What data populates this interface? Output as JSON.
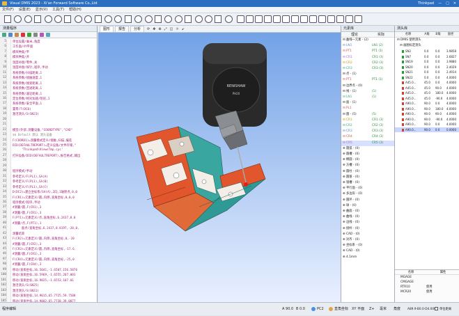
{
  "window": {
    "title": "Visual DMIS 2023 - Xi'an Forward Software Co.,Ltd",
    "user": "Thinkpad",
    "controls": [
      "—",
      "□",
      "✕"
    ]
  },
  "menu": [
    "文件(F)",
    "设置(E)",
    "显示(V)",
    "工具(T)",
    "帮助(H)"
  ],
  "left_panel": {
    "title": "测量程序",
    "lines": [
      {
        "n": "5",
        "t": "单位设置/毫米,角度",
        "c": ""
      },
      {
        "n": "6",
        "t": "工作面/XY平面",
        "c": ""
      },
      {
        "n": "7",
        "t": "模块种类/平",
        "c": ""
      },
      {
        "n": "8",
        "t": "模块种类/开",
        "c": ""
      },
      {
        "n": "9",
        "t": "温度补偿/零件,关",
        "c": ""
      },
      {
        "n": "10",
        "t": "温度补偿/探针,程序,手动",
        "c": ""
      },
      {
        "n": "11",
        "t": "系统参数/扫描距离,1",
        "c": ""
      },
      {
        "n": "12",
        "t": "系统参数/接触速度,1",
        "c": ""
      },
      {
        "n": "13",
        "t": "系统参数/搜索距离,1",
        "c": ""
      },
      {
        "n": "14",
        "t": "系统参数/回退距离,1",
        "c": ""
      },
      {
        "n": "15",
        "t": "系统参数/逼近距离,1",
        "c": ""
      },
      {
        "n": "16",
        "t": "定位参数/相对加速/阻尼,1",
        "c": ""
      },
      {
        "n": "17",
        "t": "系统参数/安全平面,1",
        "c": ""
      },
      {
        "n": "18",
        "t": "置零/T(DC0)",
        "c": ""
      },
      {
        "n": "19",
        "t": "激活测头/S(SN23)",
        "c": ""
      },
      {
        "n": "20",
        "t": "",
        "c": ""
      },
      {
        "n": "21",
        "t": "",
        "c": ""
      },
      {
        "n": "22",
        "t": "模型/外部,测量设备,\"COORDTYPE\",\"CAD\"",
        "c": ""
      },
      {
        "n": "23",
        "t": "$$ Default 默认 测头设备",
        "c": "gray"
      },
      {
        "n": "24",
        "t": "F(COORD1)=测量模式定义/接触,扫描,偏差",
        "c": ""
      },
      {
        "n": "25",
        "t": "DID(DEFAULTREPORT)=定义设备/文件存储,\"",
        "c": ""
      },
      {
        "n": "26",
        "t": "     'Thinkpad\\ViewsTmp.cyc'",
        "c": ""
      },
      {
        "n": "27",
        "t": "打开设备/DID(DEFAULTREPORT),报告格式,输出",
        "c": ""
      },
      {
        "n": "28",
        "t": "",
        "c": ""
      },
      {
        "n": "29",
        "t": "",
        "c": ""
      },
      {
        "n": "30",
        "t": "程序模式/手动",
        "c": ""
      },
      {
        "n": "31",
        "t": "参考定义/F(PL1),SA(A)",
        "c": ""
      },
      {
        "n": "32",
        "t": "参考定义/F(PL1),SA(B)",
        "c": ""
      },
      {
        "n": "33",
        "t": "参考定义/F(PL1),SA(C)",
        "c": ""
      },
      {
        "n": "34",
        "t": "D(DC2)=建立坐标系/SA(A),Z向,1轴原点,0,0",
        "c": ""
      },
      {
        "n": "35",
        "t": "F(CR1)=元素定义/圆,内侧,直角坐标,0,0,0",
        "c": ""
      },
      {
        "n": "36",
        "t": "程序模式/程序,手动",
        "c": ""
      },
      {
        "n": "37",
        "t": "#测量/圆,F(CR1),3",
        "c": ""
      },
      {
        "n": "38",
        "t": "#测量/圆,F(CR1),3",
        "c": ""
      },
      {
        "n": "39",
        "t": "F(PT1)=元素定义/点,直角坐标,6.2437,8.8",
        "c": ""
      },
      {
        "n": "40",
        "t": "#测量/点,F(PT1),1",
        "c": ""
      },
      {
        "n": "41",
        "t": "     面点/直角坐标,6.2437,8.8197,-20,0,",
        "c": ""
      },
      {
        "n": "42",
        "t": "测量结束",
        "c": ""
      },
      {
        "n": "43",
        "t": "F(CR2)=元素定义/圆,内侧,直角坐标,0,-20",
        "c": ""
      },
      {
        "n": "44",
        "t": "#测量/圆,F(CR2),3",
        "c": ""
      },
      {
        "n": "45",
        "t": "F(CR3)=元素定义/圆,内侧,直角坐标,-17.6",
        "c": ""
      },
      {
        "n": "46",
        "t": "#测量/圆,F(CR3),3",
        "c": ""
      },
      {
        "n": "97",
        "t": "F(CR4)=元素定义/圆,内侧,直角坐标,-25,0",
        "c": ""
      },
      {
        "n": "98",
        "t": "#测量/圆,F(CR4),3",
        "c": ""
      },
      {
        "n": "99",
        "t": "移动/直角坐标,16.5041,-1.6507,156.5876",
        "c": ""
      },
      {
        "n": "100",
        "t": "移动/直角坐标,16.5969,-1.6555,207.001",
        "c": ""
      },
      {
        "n": "101",
        "t": "移动/直角坐标,16.9025,-1.6553,107.01",
        "c": ""
      },
      {
        "n": "102",
        "t": "激活测头/S(SN25)",
        "c": ""
      },
      {
        "n": "103",
        "t": "激活测头/S(SN31)",
        "c": ""
      },
      {
        "n": "104",
        "t": "移动/直角坐标,14.9015,65.7725,59.7588",
        "c": ""
      },
      {
        "n": "105",
        "t": "移动/直角坐标,14.9002,65.7738,39.0077",
        "c": ""
      }
    ]
  },
  "viewport": {
    "tabs": [
      "图形",
      "报告",
      "分析"
    ],
    "probe_label": "RENISHAW",
    "probe_sub": "PH20"
  },
  "right_panel": {
    "tabs": [
      "元素库"
    ],
    "headers": [
      "理论",
      "实际"
    ],
    "rows": [
      {
        "n": "⊟ 曲线一元素 - (2)",
        "v": ""
      },
      {
        "n": "  ⊟ LN1",
        "v": "LN1 (2)"
      },
      {
        "n": "  ⊟ PT1",
        "v": "PT1 (1)"
      },
      {
        "n": "  ⊟ CR1",
        "v": "CR1 (3)"
      },
      {
        "n": "  ⊟ CR2",
        "v": "CR2 (3)"
      },
      {
        "n": "  ⊟ CR3",
        "v": "CR3 (3)"
      },
      {
        "n": "⊟ 点 - (1)",
        "v": ""
      },
      {
        "n": "  ⊟ PT1",
        "v": "PT1 (1)"
      },
      {
        "n": "⊟ 边界点 - (0)",
        "v": ""
      },
      {
        "n": "⊟ 线 - (1)",
        "v": "(1)"
      },
      {
        "n": "  ⊟ LN1",
        "v": "(1)"
      },
      {
        "n": "⊟ 面 - (1)",
        "v": ""
      },
      {
        "n": "  ⊟ PL1",
        "v": ""
      },
      {
        "n": "⊟ 圆 - (5)",
        "v": "(5)"
      },
      {
        "n": "  ⊟ CR1",
        "v": "CR1 (3)"
      },
      {
        "n": "  ⊟ CR2",
        "v": "CR2 (3)"
      },
      {
        "n": "  ⊟ CR3",
        "v": "CR3 (3)"
      },
      {
        "n": "  ⊟ CR4",
        "v": "CR4 (3)"
      },
      {
        "n": "  ⊟ CR5",
        "v": "CR5 (3)"
      },
      {
        "n": "⊕ 圆弧 - (0)",
        "v": ""
      },
      {
        "n": "⊕ 圆槽 - (0)",
        "v": ""
      },
      {
        "n": "⊕ 椭圆 - (0)",
        "v": ""
      },
      {
        "n": "⊕ 方槽 - (0)",
        "v": ""
      },
      {
        "n": "⊕ 圆柱 - (0)",
        "v": ""
      },
      {
        "n": "⊕ 圆锥 - (0)",
        "v": ""
      },
      {
        "n": "⊕ 锥槽 - (0)",
        "v": ""
      },
      {
        "n": "⊕ 平行面 - (0)",
        "v": ""
      },
      {
        "n": "⊕ 多边形 - (0)",
        "v": ""
      },
      {
        "n": "⊕ 圆环 - (0)",
        "v": ""
      },
      {
        "n": "⊕ 球 - (0)",
        "v": ""
      },
      {
        "n": "⊕ 曲面 - (0)",
        "v": ""
      },
      {
        "n": "⊕ 曲线 - (0)",
        "v": ""
      },
      {
        "n": "⊕ 边线 - (0)",
        "v": ""
      },
      {
        "n": "⊕ 接杆 - (0)",
        "v": ""
      },
      {
        "n": "⊕ CAD - (0)",
        "v": ""
      },
      {
        "n": "⊕ 对齐 - (0)",
        "v": ""
      },
      {
        "n": "⊕ 坐标系 - (0)",
        "v": ""
      },
      {
        "n": "⊕ CAD - (0)",
        "v": ""
      },
      {
        "n": "  ⊕ 4.1mm",
        "v": ""
      }
    ]
  },
  "far_panel": {
    "tabs": [
      "测头库"
    ],
    "headers": [
      "名称",
      "A角",
      "B角",
      "直径"
    ],
    "root": "DMIS 使用测头",
    "group": "画图标定测头",
    "rows": [
      {
        "n": "SN2",
        "a": "0.0",
        "b": "0.0",
        "d": "3.9858"
      },
      {
        "n": "SN7",
        "a": "0.0",
        "b": "0.0",
        "d": "2.6827"
      },
      {
        "n": "SN19",
        "a": "0.0",
        "b": "0.0",
        "d": "3.9880"
      },
      {
        "n": "SN20",
        "a": "0.0",
        "b": "0.0",
        "d": "2.4029"
      },
      {
        "n": "SN21",
        "a": "0.0",
        "b": "0.0",
        "d": "2.4914"
      },
      {
        "n": "SN22",
        "a": "0.0",
        "b": "0.0",
        "d": "4.0000"
      },
      {
        "n": "A45.0...",
        "a": "45.0",
        "b": "0.0",
        "d": "4.0000"
      },
      {
        "n": "A45.0...",
        "a": "45.0",
        "b": "90.0",
        "d": "4.0000"
      },
      {
        "n": "A45.0...",
        "a": "45.0",
        "b": "180.0",
        "d": "4.0000"
      },
      {
        "n": "A45.0...",
        "a": "45.0",
        "b": "-90.0",
        "d": "4.0000"
      },
      {
        "n": "A90.0...",
        "a": "90.0",
        "b": "0.0",
        "d": "4.0000"
      },
      {
        "n": "A90.0...",
        "a": "90.0",
        "b": "180.0",
        "d": "4.0000"
      },
      {
        "n": "A90.0...",
        "a": "90.0",
        "b": "90.0",
        "d": "4.0000"
      },
      {
        "n": "A90.0...",
        "a": "90.0",
        "b": "-90.0",
        "d": "4.0000"
      },
      {
        "n": "A90.0...",
        "a": "90.0",
        "b": "0.0",
        "d": "4.0000"
      },
      {
        "n": "A90.0...",
        "a": "90.0",
        "b": "0.0",
        "d": "0.0000"
      }
    ],
    "props_headers": [
      "名称",
      "属性"
    ],
    "props": [
      {
        "n": "MGAGE",
        "v": ""
      },
      {
        "n": "CMGAGE",
        "v": ""
      },
      {
        "n": "RTR10",
        "v": "使用"
      },
      {
        "n": "MCR20",
        "v": "使用"
      }
    ]
  },
  "status": {
    "left": "程序编辑",
    "a": "A 90.0",
    "b": "B 0.0",
    "coord": "PC2",
    "mode": "直角坐标",
    "plane": "XY 平面",
    "dir": "Z+",
    "unit": "毫米",
    "angle": "角度",
    "probe": "A89.9-B0.0-D4.000",
    "check": "单位距离"
  },
  "colors": {
    "titlebar": "#2c6fc0",
    "part": "#e2562e",
    "part_teal": "#3aa6a0",
    "probe": "#2a2a2a",
    "sky_top": "#6fa0e6",
    "sky_bottom": "#e9f0ff"
  }
}
